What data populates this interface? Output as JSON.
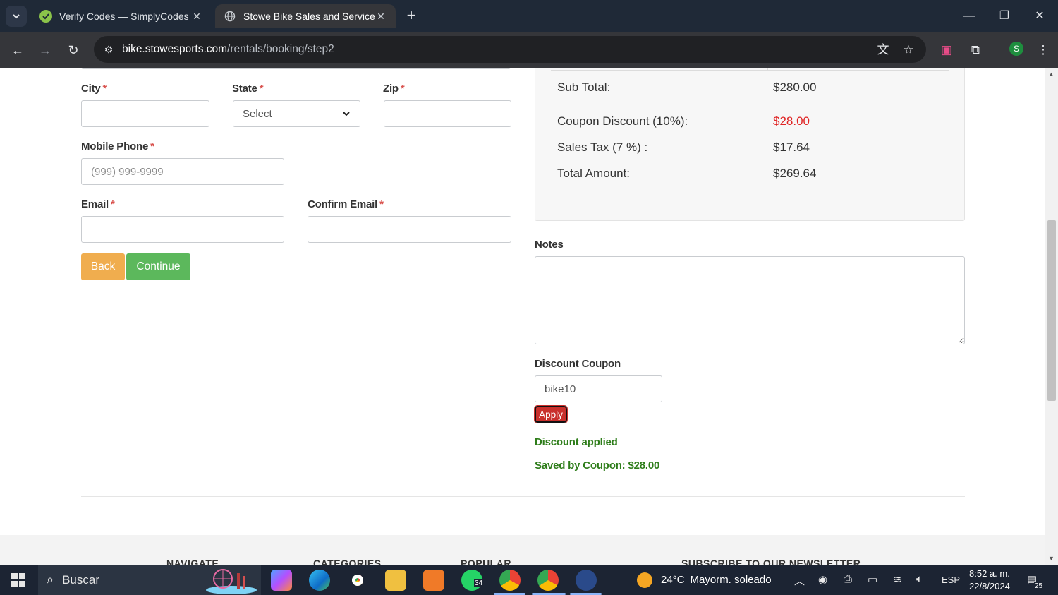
{
  "browser": {
    "tabs": [
      {
        "title": "Verify Codes — SimplyCodes",
        "active": false
      },
      {
        "title": "Stowe Bike Sales and Service / Stowe Sports",
        "active": true
      }
    ],
    "url_host": "bike.stowesports.com",
    "url_path": "/rentals/booking/step2",
    "profile_initial": "S"
  },
  "form": {
    "city_label": "City",
    "state_label": "State",
    "state_value": "Select",
    "zip_label": "Zip",
    "mobile_label": "Mobile Phone",
    "mobile_placeholder": "(999) 999-9999",
    "email_label": "Email",
    "confirm_email_label": "Confirm Email",
    "required_mark": "*",
    "back_label": "Back",
    "continue_label": "Continue"
  },
  "summary": {
    "rows": [
      {
        "label": "Sub Total:",
        "value": "$280.00"
      },
      {
        "label": "Coupon Discount (10%):",
        "value": "$28.00"
      },
      {
        "label": "Sales Tax (7 %) :",
        "value": "$17.64"
      },
      {
        "label": "Total Amount:",
        "value": "$269.64"
      }
    ],
    "discount_color": "#e02424"
  },
  "notes": {
    "label": "Notes"
  },
  "coupon": {
    "label": "Discount Coupon",
    "value": "bike10",
    "apply_label": "Apply",
    "status": "Discount applied",
    "saved": "Saved by Coupon: $28.00"
  },
  "footer": {
    "headings": [
      "NAVIGATE",
      "CATEGORIES",
      "POPULAR",
      "SUBSCRIBE TO OUR NEWSLETTER"
    ]
  },
  "taskbar": {
    "search_text": "Buscar",
    "whatsapp_badge": "34",
    "weather_temp": "24°C",
    "weather_desc": "Mayorm. soleado",
    "language": "ESP",
    "time": "8:52 a. m.",
    "date": "22/8/2024",
    "notifications": "25"
  }
}
